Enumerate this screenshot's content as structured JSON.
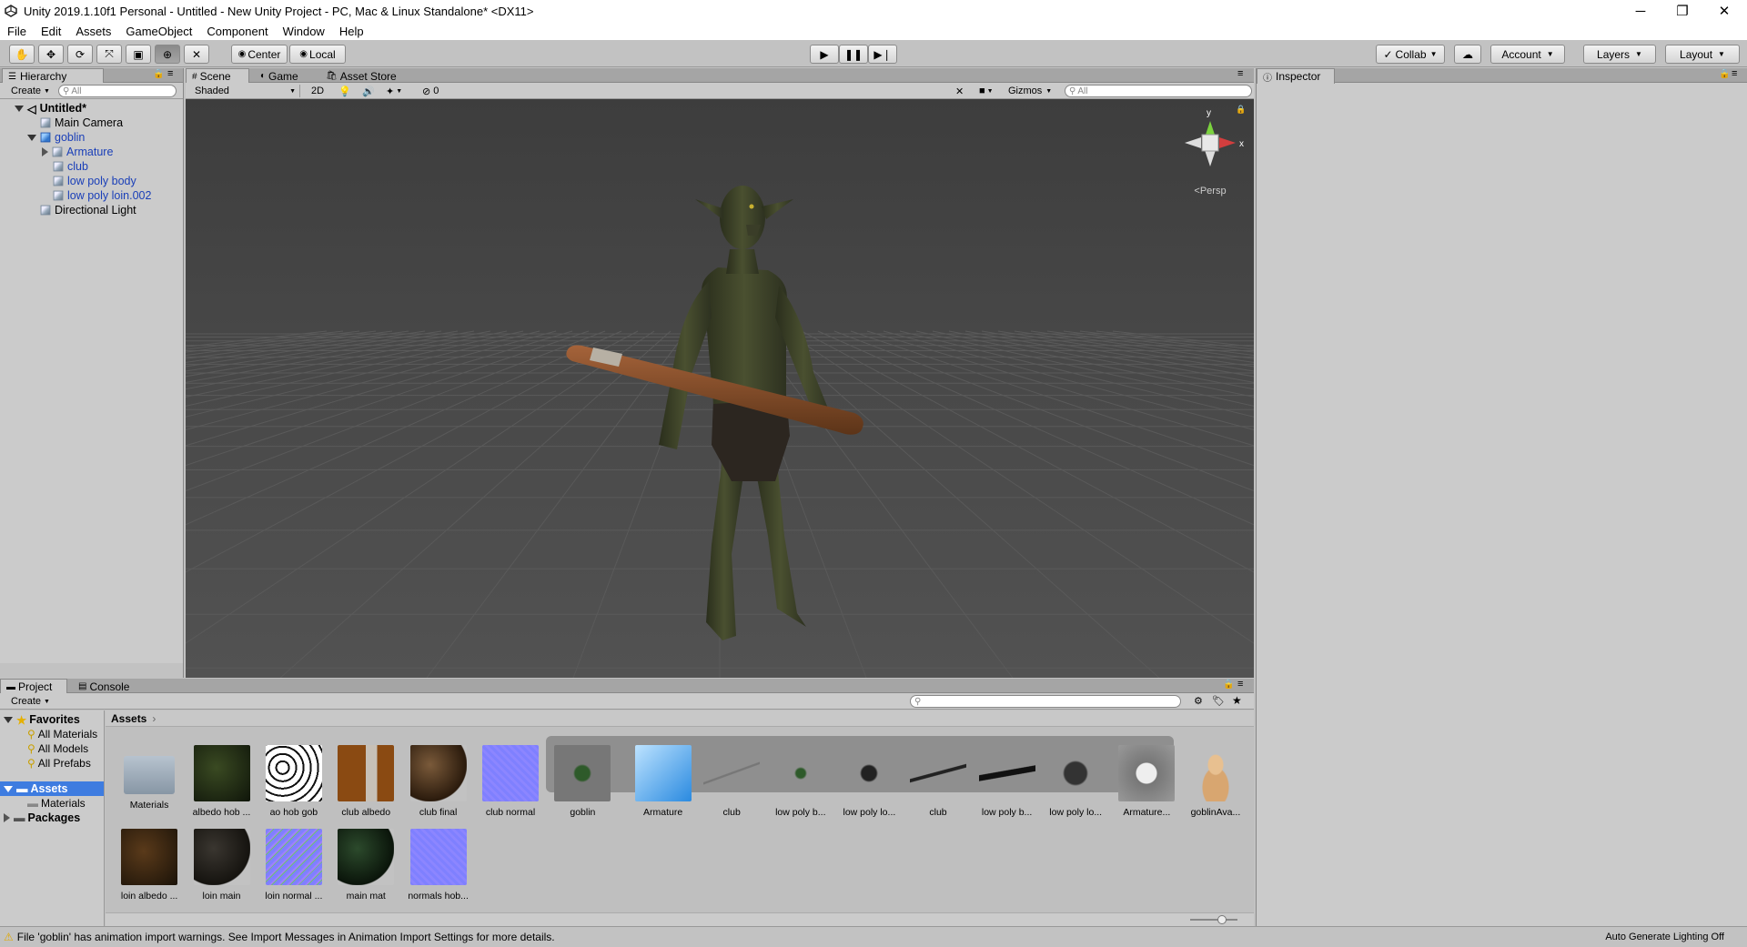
{
  "window": {
    "title": "Unity 2019.1.10f1 Personal - Untitled - New Unity Project - PC, Mac & Linux Standalone* <DX11>",
    "minimize": "─",
    "maximize": "❐",
    "close": "✕"
  },
  "menu": [
    "File",
    "Edit",
    "Assets",
    "GameObject",
    "Component",
    "Window",
    "Help"
  ],
  "toolbar": {
    "center": "Center",
    "local": "Local",
    "collab": "Collab",
    "account": "Account",
    "layers": "Layers",
    "layout": "Layout"
  },
  "hierarchy": {
    "tab": "Hierarchy",
    "create": "Create",
    "search_placeholder": "All",
    "scene": "Untitled*",
    "items": [
      {
        "label": "Main Camera"
      },
      {
        "label": "goblin"
      },
      {
        "label": "Armature"
      },
      {
        "label": "club"
      },
      {
        "label": "low poly body"
      },
      {
        "label": "low poly loin.002"
      },
      {
        "label": "Directional Light"
      }
    ]
  },
  "scene": {
    "tabs": [
      "Scene",
      "Game",
      "Asset Store"
    ],
    "shading": "Shaded",
    "mode_2d": "2D",
    "effects_count": "0",
    "gizmos": "Gizmos",
    "search_placeholder": "All",
    "persp": "Persp",
    "gizmo_y": "y",
    "gizmo_x": "x"
  },
  "inspector": {
    "tab": "Inspector"
  },
  "project": {
    "tabs": [
      "Project",
      "Console"
    ],
    "create": "Create",
    "favorites": {
      "label": "Favorites",
      "items": [
        "All Materials",
        "All Models",
        "All Prefabs"
      ]
    },
    "assets_folder": "Assets",
    "materials_folder": "Materials",
    "packages": "Packages",
    "breadcrumb": "Assets",
    "assets": [
      {
        "label": "Materials",
        "kind": "folder"
      },
      {
        "label": "albedo hob ...",
        "kind": "albedo"
      },
      {
        "label": "ao hob gob",
        "kind": "ao"
      },
      {
        "label": "club albedo",
        "kind": "clubalbedo"
      },
      {
        "label": "club final",
        "kind": "sphere-brown"
      },
      {
        "label": "club normal",
        "kind": "normal"
      },
      {
        "label": "goblin",
        "kind": "goblin"
      },
      {
        "label": "Armature",
        "kind": "cube"
      },
      {
        "label": "club",
        "kind": "stick"
      },
      {
        "label": "low poly b...",
        "kind": "goblin-small"
      },
      {
        "label": "low poly lo...",
        "kind": "loin"
      },
      {
        "label": "club",
        "kind": "stick2"
      },
      {
        "label": "low poly b...",
        "kind": "armature-small"
      },
      {
        "label": "low poly lo...",
        "kind": "mesh"
      },
      {
        "label": "Armature...",
        "kind": "anim"
      },
      {
        "label": "goblinAva...",
        "kind": "avatar"
      },
      {
        "label": "loin albedo ...",
        "kind": "loinalbedo"
      },
      {
        "label": "loin main",
        "kind": "sphere-dark"
      },
      {
        "label": "loin normal ...",
        "kind": "normal2"
      },
      {
        "label": "main mat",
        "kind": "sphere-green"
      },
      {
        "label": "normals hob...",
        "kind": "normal"
      }
    ]
  },
  "status": {
    "warning": "File 'goblin' has animation import warnings. See Import Messages in Animation Import Settings for more details.",
    "lighting": "Auto Generate Lighting Off"
  },
  "colors": {
    "scene_bg": "#444444",
    "selection_blue": "#1a3fb8",
    "panel_bg": "#c2c2c2"
  }
}
